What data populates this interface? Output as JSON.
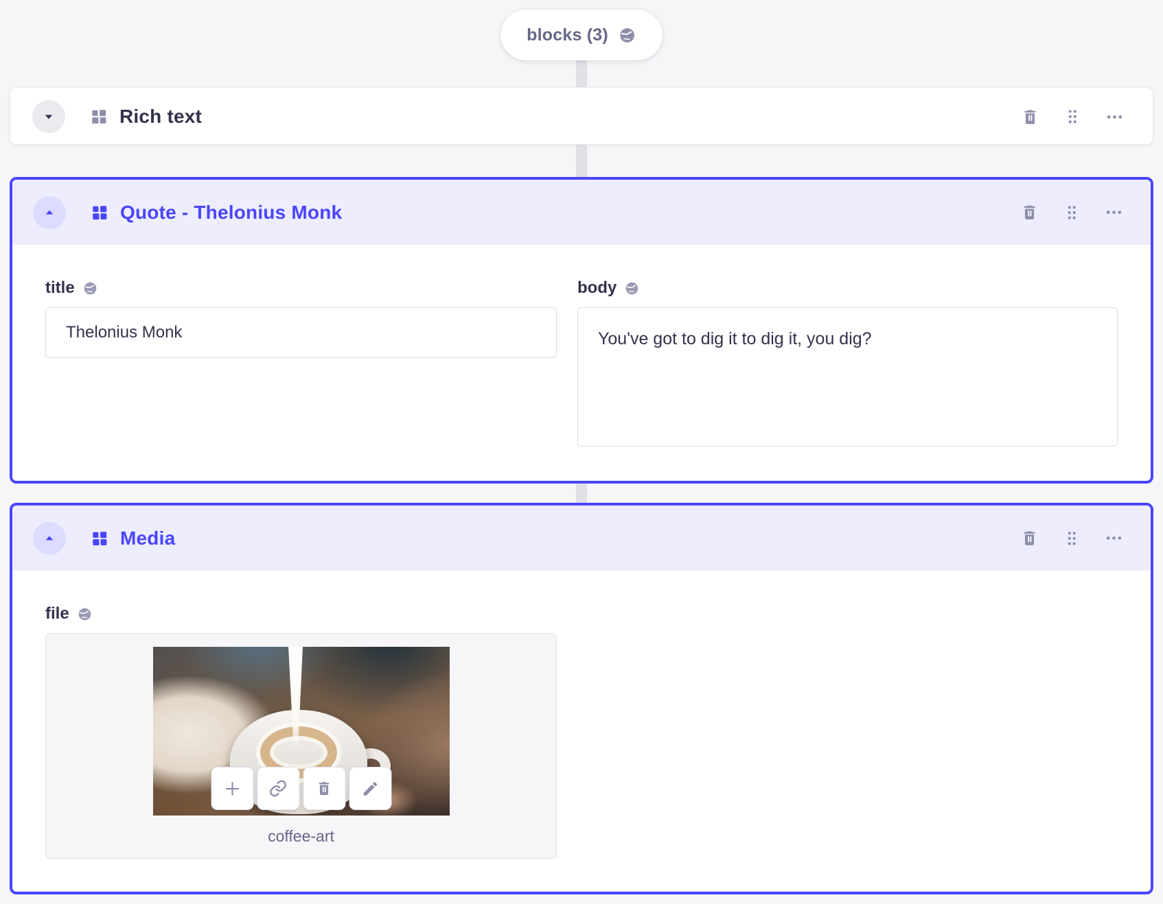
{
  "pill": {
    "label": "blocks (3)",
    "icon": "globe-icon"
  },
  "cards": [
    {
      "title": "Rich text",
      "state": "collapsed",
      "selected": false,
      "actions": [
        "delete",
        "drag",
        "more"
      ]
    },
    {
      "title": "Quote - Thelonius Monk",
      "state": "expanded",
      "selected": true,
      "actions": [
        "delete",
        "drag",
        "more"
      ],
      "fields": {
        "title": {
          "label": "title",
          "value": "Thelonius Monk",
          "localized": true
        },
        "body": {
          "label": "body",
          "value": "You've got to dig it to dig it, you dig?",
          "localized": true
        }
      }
    },
    {
      "title": "Media",
      "state": "expanded",
      "selected": true,
      "actions": [
        "delete",
        "drag",
        "more"
      ],
      "fields": {
        "file": {
          "label": "file",
          "filename": "coffee-art",
          "localized": true,
          "image_actions": [
            "add",
            "copy-link",
            "delete",
            "edit"
          ]
        }
      }
    }
  ],
  "icons": {
    "globe": "globe-icon",
    "caret_down": "caret-down-icon",
    "caret_up": "caret-up-icon",
    "grid": "component-grid-icon",
    "trash": "trash-icon",
    "drag": "drag-handle-icon",
    "more": "more-icon",
    "plus": "plus-icon",
    "link": "link-icon",
    "pencil": "pencil-icon"
  },
  "colors": {
    "primary": "#4945FF",
    "primary_header_bg": "#EDEDFE",
    "primary_toggle_bg": "#DDDCFE",
    "page_bg": "#F6F6F9",
    "neutral_icon": "#8E8EA9",
    "text_dark": "#32324D",
    "text_muted": "#666687",
    "input_border": "#DCDCE4",
    "connector": "#E0E0E6"
  }
}
